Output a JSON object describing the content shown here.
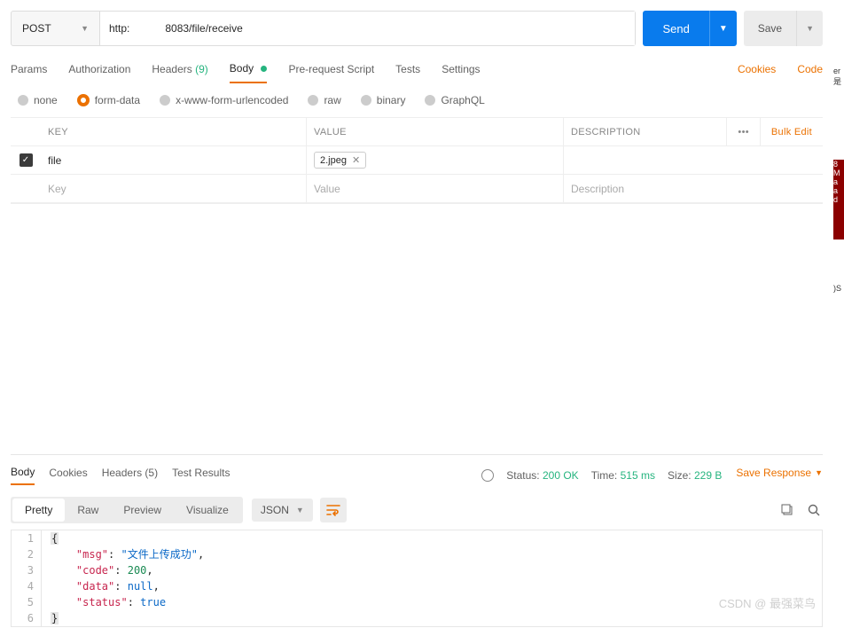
{
  "request": {
    "method": "POST",
    "url": "http:            8083/file/receive",
    "send_label": "Send",
    "save_label": "Save"
  },
  "reqTabs": {
    "params": "Params",
    "auth": "Authorization",
    "headers": "Headers",
    "headers_count": "(9)",
    "body": "Body",
    "prereq": "Pre-request Script",
    "tests": "Tests",
    "settings": "Settings",
    "cookies": "Cookies",
    "code": "Code"
  },
  "bodyTypes": {
    "none": "none",
    "formdata": "form-data",
    "urlencoded": "x-www-form-urlencoded",
    "raw": "raw",
    "binary": "binary",
    "graphql": "GraphQL"
  },
  "kvHeader": {
    "key": "KEY",
    "value": "VALUE",
    "desc": "DESCRIPTION",
    "dots": "•••",
    "bulk": "Bulk Edit"
  },
  "kvRow": {
    "key": "file",
    "file": "2.jpeg"
  },
  "kvPlaceholder": {
    "key": "Key",
    "value": "Value",
    "desc": "Description"
  },
  "respTabs": {
    "body": "Body",
    "cookies": "Cookies",
    "headers": "Headers",
    "headers_count": "(5)",
    "tests": "Test Results"
  },
  "respMeta": {
    "status_label": "Status:",
    "status_val": "200 OK",
    "time_label": "Time:",
    "time_val": "515 ms",
    "size_label": "Size:",
    "size_val": "229 B",
    "save": "Save Response"
  },
  "viewTabs": {
    "pretty": "Pretty",
    "raw": "Raw",
    "preview": "Preview",
    "visualize": "Visualize"
  },
  "format": "JSON",
  "json": {
    "l1": "{",
    "l2k": "\"msg\"",
    "l2v": "\"文件上传成功\"",
    "l3k": "\"code\"",
    "l3v": "200",
    "l4k": "\"data\"",
    "l4v": "null",
    "l5k": "\"status\"",
    "l5v": "true",
    "l6": "}"
  },
  "watermark": "CSDN @ 最强菜鸟"
}
